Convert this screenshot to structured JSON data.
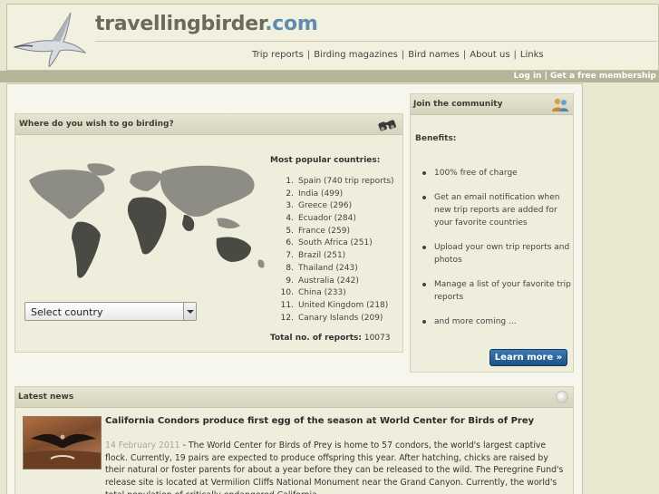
{
  "header": {
    "title_main": "travellingbirder",
    "title_tld": ".com",
    "nav": [
      "Trip reports",
      "Birding magazines",
      "Bird names",
      "About us",
      "Links"
    ],
    "nav_separator": "|"
  },
  "topbar": {
    "login": "Log in",
    "separator": "|",
    "membership": "Get a free membership"
  },
  "where": {
    "title": "Where do you wish to go birding?",
    "icon": "binoculars-icon",
    "select_value": "Select country",
    "popular_title": "Most popular countries:",
    "countries": [
      {
        "num": "1.",
        "name": "Spain (740 trip reports)"
      },
      {
        "num": "2.",
        "name": "India (499)"
      },
      {
        "num": "3.",
        "name": "Greece (296)"
      },
      {
        "num": "4.",
        "name": "Ecuador (284)"
      },
      {
        "num": "5.",
        "name": "France (259)"
      },
      {
        "num": "6.",
        "name": "South Africa (251)"
      },
      {
        "num": "7.",
        "name": "Brazil (251)"
      },
      {
        "num": "8.",
        "name": "Thailand (243)"
      },
      {
        "num": "9.",
        "name": "Australia (242)"
      },
      {
        "num": "10.",
        "name": "China (233)"
      },
      {
        "num": "11.",
        "name": "United Kingdom (218)"
      },
      {
        "num": "12.",
        "name": "Canary Islands (209)"
      }
    ],
    "total_label": "Total no. of reports:",
    "total_value": "10073"
  },
  "community": {
    "title": "Join the community",
    "icon": "people-icon",
    "benefits_label": "Benefits:",
    "benefits": [
      "100% free of charge",
      "Get an email notification when new trip reports are added for your favorite countries",
      "Upload your own trip reports and photos",
      "Manage a list of your favorite trip reports",
      "and more coming ..."
    ],
    "learn_more": "Learn more »"
  },
  "news": {
    "title": "Latest news",
    "icon": "rss-icon",
    "item_title": "California Condors produce first egg of the season at World Center for Birds of Prey",
    "date": "14 February 2011",
    "body": " - The World Center for Birds of Prey is home to 57 condors, the world's largest captive flock. Currently, 19 pairs are expected to produce offspring this year. After hatching, chicks are raised by their natural or foster parents for about a year before they can be released to the wild. The Peregrine Fund's release site is located at Vermilion Cliffs National Monument near the Grand Canyon. Currently, the world's total population of critically endangered California"
  },
  "colors": {
    "background": "#e9e7cf",
    "accent_tld": "#5f8db0",
    "button": "#2a64a0"
  }
}
